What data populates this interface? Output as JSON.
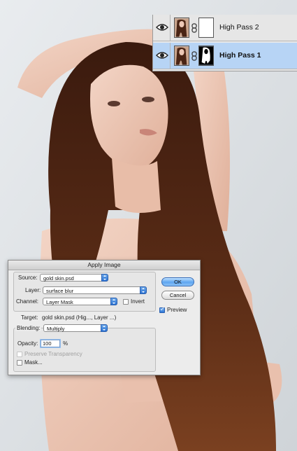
{
  "layers_panel": {
    "layers": [
      {
        "name": "High Pass 2",
        "visible": true,
        "selected": false
      },
      {
        "name": "High Pass 1",
        "visible": true,
        "selected": true
      }
    ]
  },
  "apply_image": {
    "title": "Apply Image",
    "source_label": "Source:",
    "source_value": "gold skin.psd",
    "layer_label": "Layer:",
    "layer_value": "surface blur",
    "channel_label": "Channel:",
    "channel_value": "Layer Mask",
    "invert_label": "Invert",
    "invert_checked": false,
    "target_label": "Target:",
    "target_value": "gold skin.psd (Hig..., Layer ...)",
    "blending_label": "Blending:",
    "blending_value": "Multiply",
    "opacity_label": "Opacity:",
    "opacity_value": "100",
    "opacity_unit": "%",
    "preserve_transparency_label": "Preserve Transparency",
    "preserve_transparency_checked": false,
    "mask_label": "Mask...",
    "mask_checked": false,
    "ok_label": "OK",
    "cancel_label": "Cancel",
    "preview_label": "Preview",
    "preview_checked": true
  },
  "colors": {
    "selected_layer_bg": "#b7d4f5",
    "default_button": "#5ea6f0",
    "hair": "#4a2414"
  }
}
